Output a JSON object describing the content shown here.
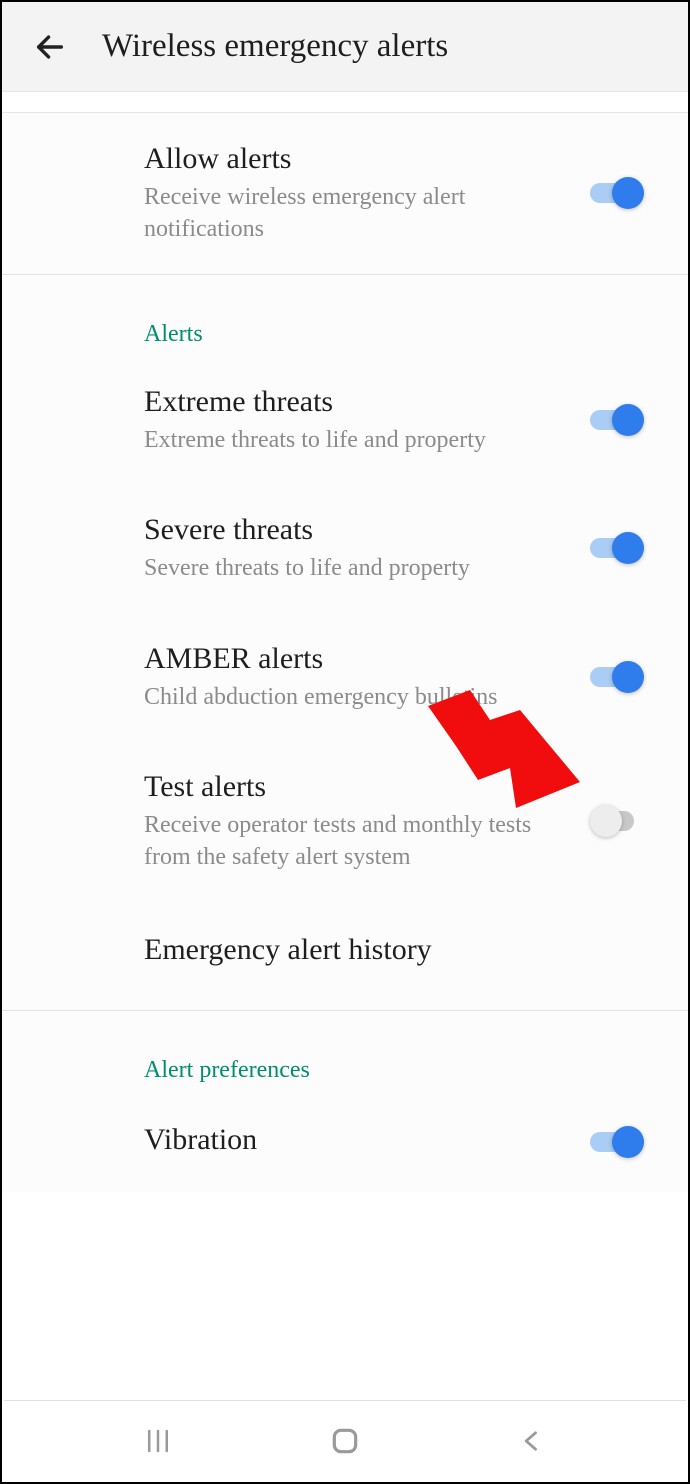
{
  "header": {
    "title": "Wireless emergency alerts"
  },
  "allow": {
    "title": "Allow alerts",
    "sub": "Receive wireless emergency alert notifications",
    "on": true
  },
  "alerts_header": "Alerts",
  "alerts": [
    {
      "key": "extreme",
      "title": "Extreme threats",
      "sub": "Extreme threats to life and property",
      "on": true
    },
    {
      "key": "severe",
      "title": "Severe threats",
      "sub": "Severe threats to life and property",
      "on": true
    },
    {
      "key": "amber",
      "title": "AMBER alerts",
      "sub": "Child abduction emergency bulletins",
      "on": true
    },
    {
      "key": "test",
      "title": "Test alerts",
      "sub": "Receive operator tests and monthly tests from the safety alert system",
      "on": false
    }
  ],
  "history": {
    "title": "Emergency alert history"
  },
  "prefs_header": "Alert preferences",
  "prefs": [
    {
      "key": "vibration",
      "title": "Vibration",
      "on": true
    }
  ],
  "annotation": {
    "arrow_color": "#f10d0d"
  }
}
